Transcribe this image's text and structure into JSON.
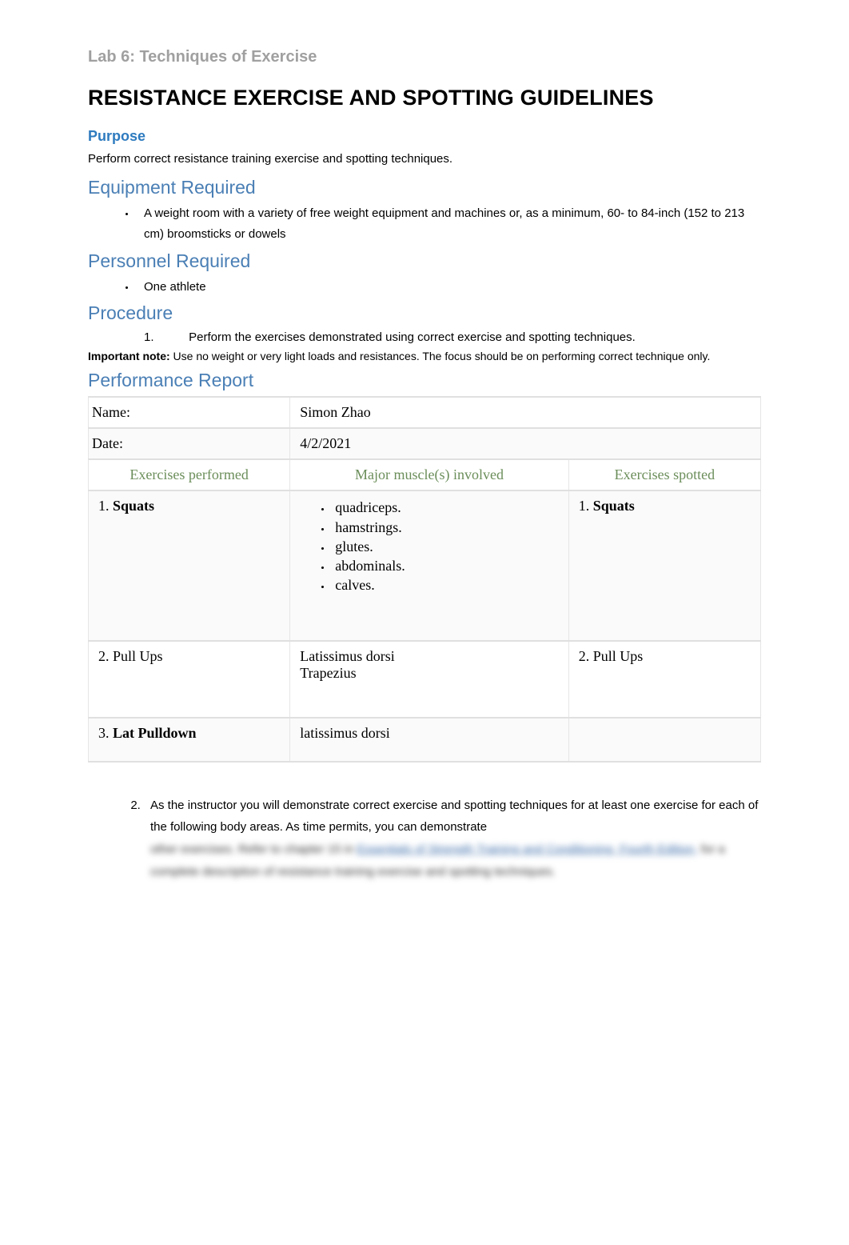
{
  "subtitle": "Lab 6: Techniques of Exercise",
  "title": "RESISTANCE EXERCISE AND SPOTTING GUIDELINES",
  "purpose": {
    "heading": "Purpose",
    "text": "Perform correct resistance training exercise and spotting techniques."
  },
  "equipment": {
    "heading": "Equipment Required",
    "items": [
      "A weight room with a variety of free weight equipment and machines or, as a minimum, 60- to 84-inch (152 to 213 cm) broomsticks or dowels"
    ]
  },
  "personnel": {
    "heading": "Personnel Required",
    "items": [
      "One athlete"
    ]
  },
  "procedure": {
    "heading": "Procedure",
    "step1_num": "1.",
    "step1_text": "Perform the exercises demonstrated using correct exercise and spotting techniques.",
    "important_label": "Important note:",
    "important_text": " Use no weight or very light loads and resistances. The focus should be on performing correct technique only."
  },
  "report": {
    "heading": "Performance Report",
    "name_label": "Name:",
    "name_value": "Simon Zhao",
    "date_label": "Date:",
    "date_value": "4/2/2021",
    "headers": {
      "performed": "Exercises performed",
      "muscles": "Major muscle(s) involved",
      "spotted": "Exercises spotted"
    },
    "rows": [
      {
        "num": "1.",
        "performed": "Squats",
        "performed_bold": true,
        "muscles": [
          "quadriceps.",
          "hamstrings.",
          "glutes.",
          "abdominals.",
          "calves."
        ],
        "muscles_bulleted": true,
        "spotted_num": "1.",
        "spotted": "Squats",
        "spotted_bold": true
      },
      {
        "num": "2.",
        "performed": "Pull Ups",
        "performed_bold": false,
        "muscles_text": "Latissimus dorsi\nTrapezius",
        "spotted_num": "2.",
        "spotted": "Pull Ups",
        "spotted_bold": false
      },
      {
        "num": "3.",
        "performed": "Lat Pulldown",
        "performed_bold": true,
        "muscles_text": "latissimus dorsi",
        "spotted": ""
      }
    ]
  },
  "step2": {
    "num": "2",
    "text": "As the instructor you will demonstrate correct exercise and spotting techniques for at least one exercise for each of the following body areas. As time permits, you can demonstrate",
    "blur1_prefix": "other exercises. Refer to chapter 15 in ",
    "blur1_link": "Essentials of Strength Training and Conditioning, Fourth Edition,",
    "blur1_suffix": " for a complete description of resistance training exercise and spotting techniques."
  }
}
